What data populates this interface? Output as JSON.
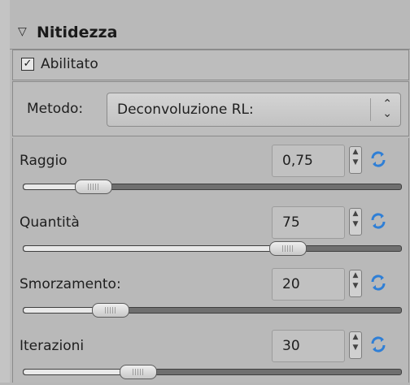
{
  "panel": {
    "title": "Nitidezza",
    "collapse_icon": "triangle-down-icon",
    "enabled_label": "Abilitato",
    "enabled_checked": true,
    "method": {
      "label": "Metodo:",
      "value": "Deconvoluzione RL:"
    },
    "params": [
      {
        "label": "Raggio",
        "value": "0,75",
        "slider_fraction": 0.15
      },
      {
        "label": "Quantità",
        "value": "75",
        "slider_fraction": 0.72
      },
      {
        "label": "Smorzamento:",
        "value": "20",
        "slider_fraction": 0.2
      },
      {
        "label": "Iterazioni",
        "value": "30",
        "slider_fraction": 0.28
      }
    ]
  },
  "icons": {
    "spin": "spin-updown-icon",
    "reset": "refresh-icon",
    "combo": "updown-chevron-icon"
  },
  "colors": {
    "accent_blue": "#2f7fd6",
    "background": "#b7b7b7"
  }
}
